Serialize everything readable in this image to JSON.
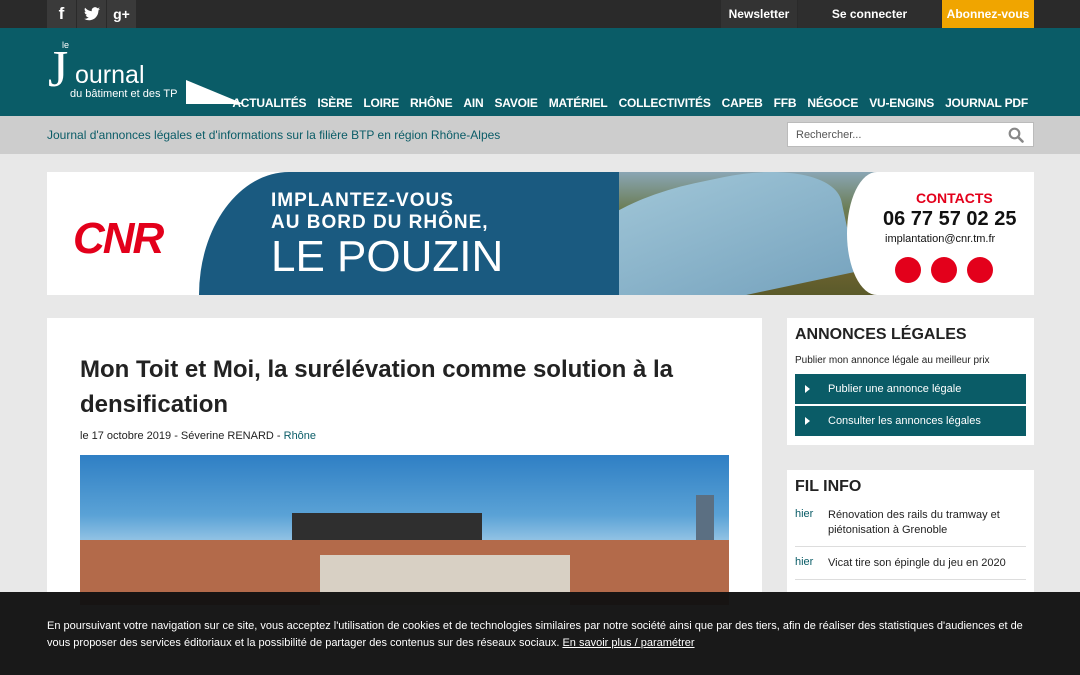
{
  "topbar": {
    "social": [
      {
        "icon": "facebook-icon",
        "glyph": "f"
      },
      {
        "icon": "twitter-icon",
        "glyph": "t"
      },
      {
        "icon": "google-plus-icon",
        "glyph": "g+"
      }
    ],
    "newsletter": "Newsletter",
    "login": "Se connecter",
    "subscribe": "Abonnez-vous"
  },
  "logo": {
    "le": "le",
    "j": "J",
    "ournal": "ournal",
    "subtitle": "du bâtiment et des TP"
  },
  "nav": [
    "ACTUALITÉS",
    "ISÈRE",
    "LOIRE",
    "RHÔNE",
    "AIN",
    "SAVOIE",
    "MATÉRIEL",
    "COLLECTIVITÉS",
    "CAPEB",
    "FFB",
    "NÉGOCE",
    "VU-ENGINS",
    "JOURNAL PDF"
  ],
  "tagline": "Journal d'annonces légales et d'informations sur la filière BTP en région Rhône-Alpes",
  "search": {
    "placeholder": "Rechercher..."
  },
  "banner": {
    "brand": "CNR",
    "line1": "IMPLANTEZ-VOUS",
    "line2": "AU BORD DU RHÔNE,",
    "line3": "LE POUZIN",
    "contacts": "CONTACTS",
    "phone": "06 77 57 02 25",
    "email": "implantation@cnr.tm.fr"
  },
  "article": {
    "title": "Mon Toit et Moi, la surélévation comme solution à la densification",
    "date": "le 17 octobre 2019",
    "sep": " - ",
    "author": "Séverine RENARD",
    "category": "Rhône"
  },
  "annonces": {
    "title": "ANNONCES LÉGALES",
    "lead": "Publier mon annonce légale au meilleur prix",
    "buttons": [
      "Publier une annonce légale",
      "Consulter les annonces légales"
    ]
  },
  "filinfo": {
    "title": "FIL INFO",
    "items": [
      {
        "when": "hier",
        "text": "Rénovation des rails du tramway et piétonisation à Grenoble"
      },
      {
        "when": "hier",
        "text": "Vicat tire son épingle du jeu en 2020"
      }
    ]
  },
  "cookie": {
    "text": "En poursuivant votre navigation sur ce site, vous acceptez l'utilisation de cookies et de technologies similaires par notre société ainsi que par des tiers, afin de réaliser des statistiques d'audiences et de vous proposer des services éditoriaux et la possibilité de partager des contenus sur des réseaux sociaux.",
    "link": "En savoir plus / paramétrer"
  },
  "colors": {
    "teal": "#0a5c67",
    "orange": "#f0a500",
    "cnr_red": "#e3001b"
  }
}
